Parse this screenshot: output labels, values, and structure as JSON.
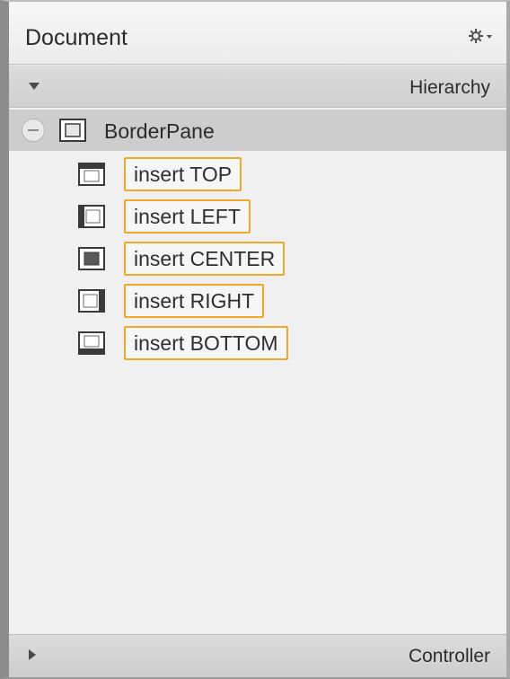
{
  "document_panel": {
    "title": "Document",
    "menu_icon": "gear-icon"
  },
  "hierarchy": {
    "label": "Hierarchy",
    "root": {
      "label": "BorderPane",
      "icon": "borderpane-icon"
    },
    "children": [
      {
        "label": "insert TOP",
        "icon": "borderpane-top-icon"
      },
      {
        "label": "insert LEFT",
        "icon": "borderpane-left-icon"
      },
      {
        "label": "insert CENTER",
        "icon": "borderpane-center-icon"
      },
      {
        "label": "insert RIGHT",
        "icon": "borderpane-right-icon"
      },
      {
        "label": "insert BOTTOM",
        "icon": "borderpane-bottom-icon"
      }
    ]
  },
  "controller": {
    "label": "Controller"
  },
  "colors": {
    "insert_border": "#f0a92a",
    "selected_row": "#cdcdcd"
  }
}
